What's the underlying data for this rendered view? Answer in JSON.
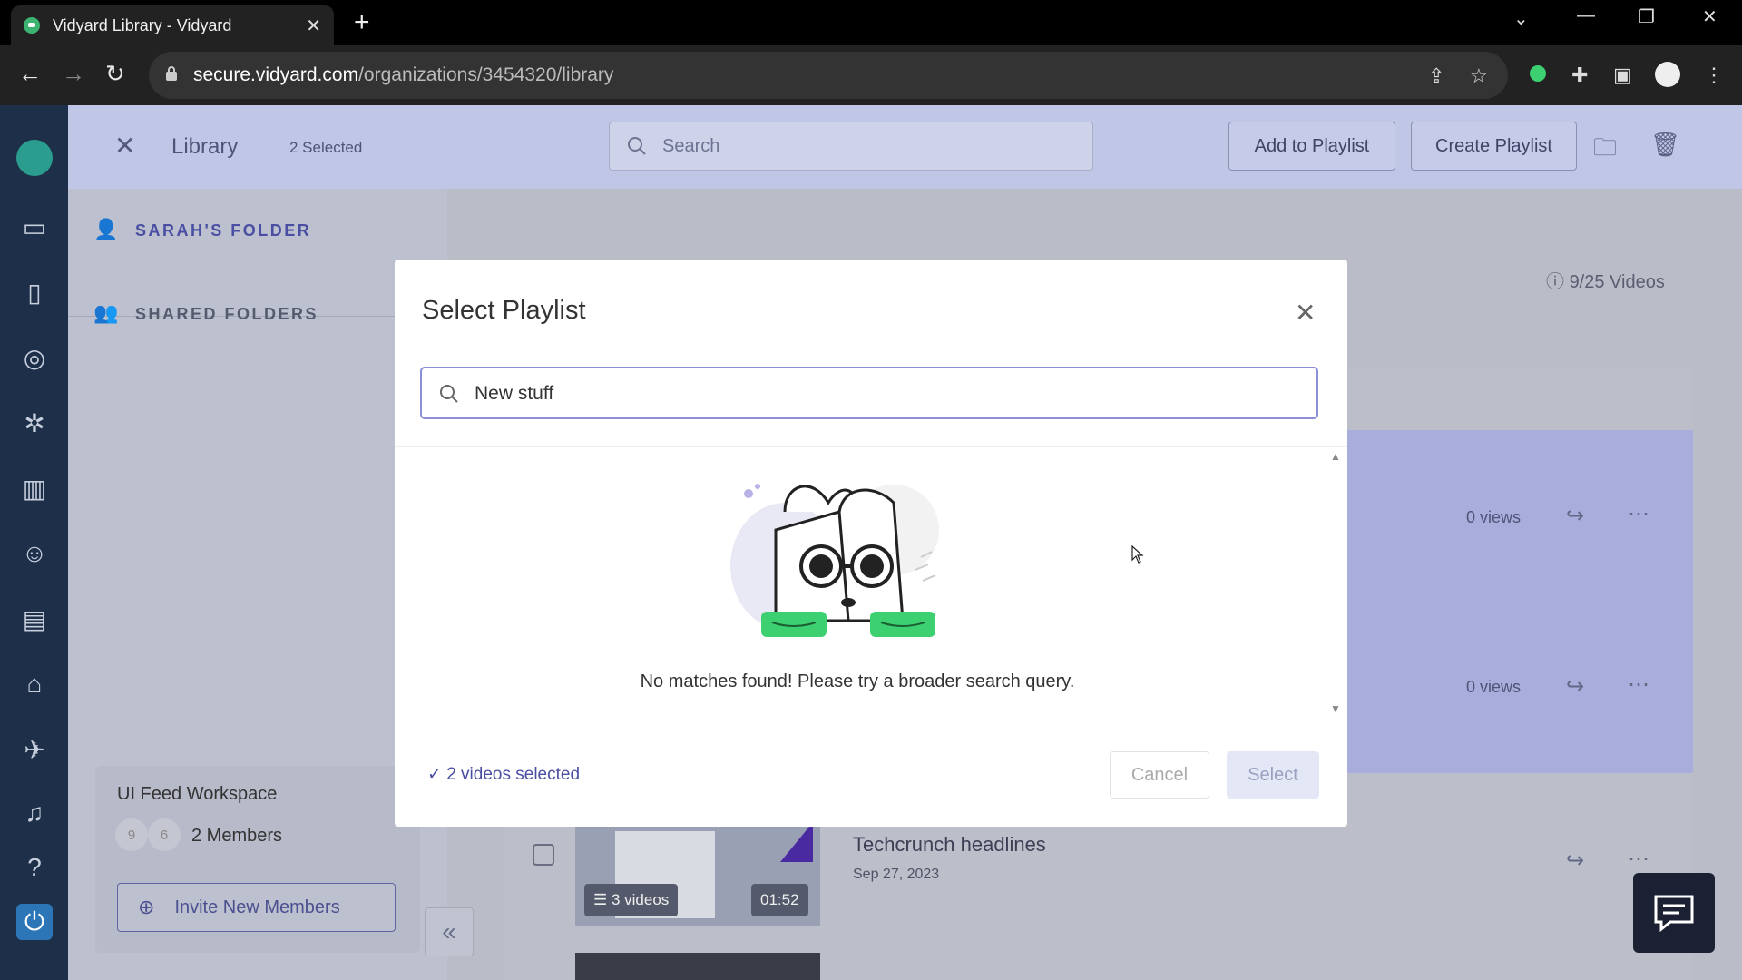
{
  "browser": {
    "tab_title": "Vidyard Library - Vidyard",
    "url_host": "secure.vidyard.com",
    "url_path": "/organizations/3454320/library"
  },
  "header": {
    "title": "Library",
    "selected_count": "2 Selected",
    "search_placeholder": "Search",
    "add_to_playlist": "Add to Playlist",
    "create_playlist": "Create Playlist"
  },
  "sidebar": {
    "my_folder": "SARAH'S FOLDER",
    "shared_folders": "SHARED FOLDERS",
    "workspace_name": "UI Feed Workspace",
    "avatars": [
      "9",
      "6"
    ],
    "members": "2 Members",
    "invite": "Invite New Members"
  },
  "library": {
    "video_count": "9/25 Videos",
    "rows": [
      {
        "views": "0 views"
      },
      {
        "views": "0 views"
      }
    ],
    "video": {
      "title": "Techcrunch headlines",
      "date": "Sep 27, 2023",
      "playlist_badge": "3 videos",
      "duration": "01:52"
    }
  },
  "modal": {
    "title": "Select Playlist",
    "search_value": "New stuff",
    "empty_message": "No matches found! Please try a broader search query.",
    "selected_summary": "2 videos selected",
    "cancel": "Cancel",
    "select": "Select"
  },
  "colors": {
    "accent": "#4a4fa3",
    "rail": "#1e2f4a",
    "brand_green": "#3cd070"
  }
}
